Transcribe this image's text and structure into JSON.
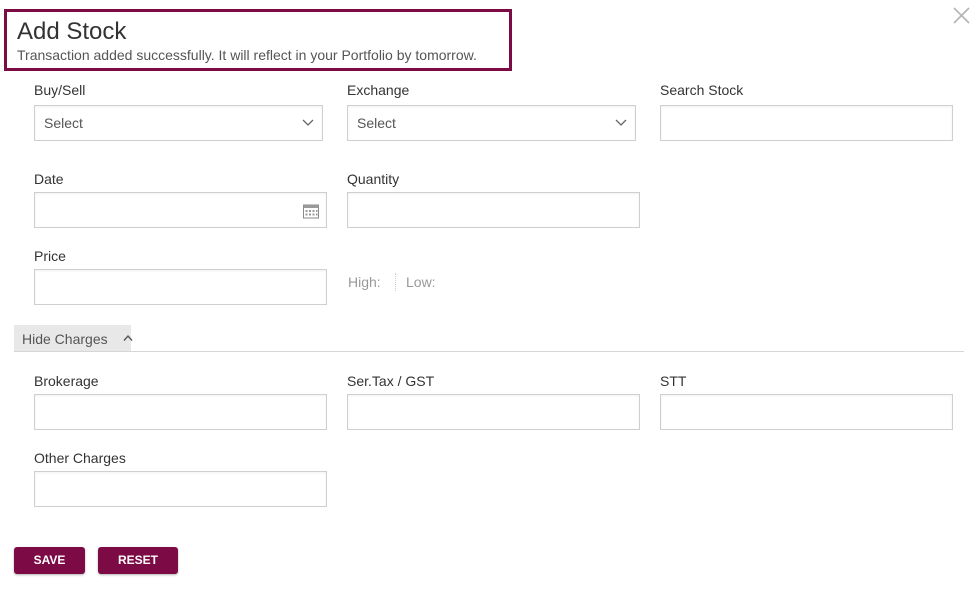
{
  "header": {
    "title": "Add Stock",
    "message": "Transaction added successfully. It will reflect in your Portfolio by tomorrow."
  },
  "form": {
    "buy_sell": {
      "label": "Buy/Sell",
      "selected": "Select"
    },
    "exchange": {
      "label": "Exchange",
      "selected": "Select"
    },
    "search_stock": {
      "label": "Search Stock",
      "value": ""
    },
    "date": {
      "label": "Date",
      "value": ""
    },
    "quantity": {
      "label": "Quantity",
      "value": ""
    },
    "price": {
      "label": "Price",
      "value": ""
    },
    "high_label": "High:",
    "low_label": "Low:"
  },
  "charges": {
    "toggle_label": "Hide Charges",
    "brokerage": {
      "label": "Brokerage",
      "value": ""
    },
    "ser_tax_gst": {
      "label": "Ser.Tax / GST",
      "value": ""
    },
    "stt": {
      "label": "STT",
      "value": ""
    },
    "other_charges": {
      "label": "Other Charges",
      "value": ""
    }
  },
  "buttons": {
    "save": "SAVE",
    "reset": "RESET"
  },
  "colors": {
    "accent": "#7b0a45"
  },
  "icons": {
    "close": "close-icon",
    "dropdown": "chevron-down-icon",
    "calendar": "calendar-icon",
    "collapse": "chevron-up-icon"
  }
}
